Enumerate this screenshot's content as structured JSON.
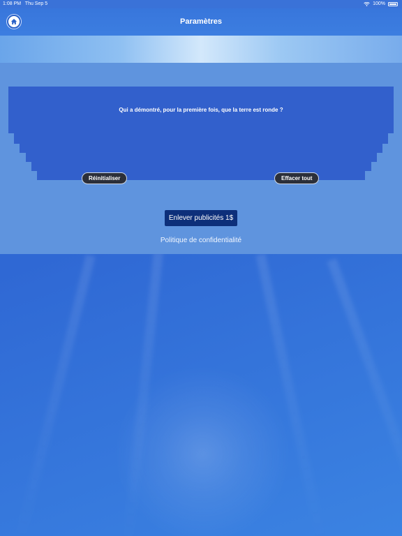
{
  "status_bar": {
    "time": "1:08 PM",
    "date": "Thu Sep 5",
    "battery": "100%"
  },
  "nav": {
    "title": "Paramètres",
    "home_icon": "home-icon"
  },
  "settings": {
    "question": "Qui a démontré, pour la première fois, que la terre est ronde ?",
    "reset_label": "Réinitialiser",
    "clear_all_label": "Effacer tout",
    "remove_ads_label": "Enlever publicités 1$",
    "privacy_label": "Politique de confidentialité"
  },
  "colors": {
    "background": "#2f68d4",
    "panel": "#5f94de",
    "question_box": "#3260cc",
    "remove_ads_button": "#0d2f7a",
    "pill_button": "#2b2f3a"
  }
}
